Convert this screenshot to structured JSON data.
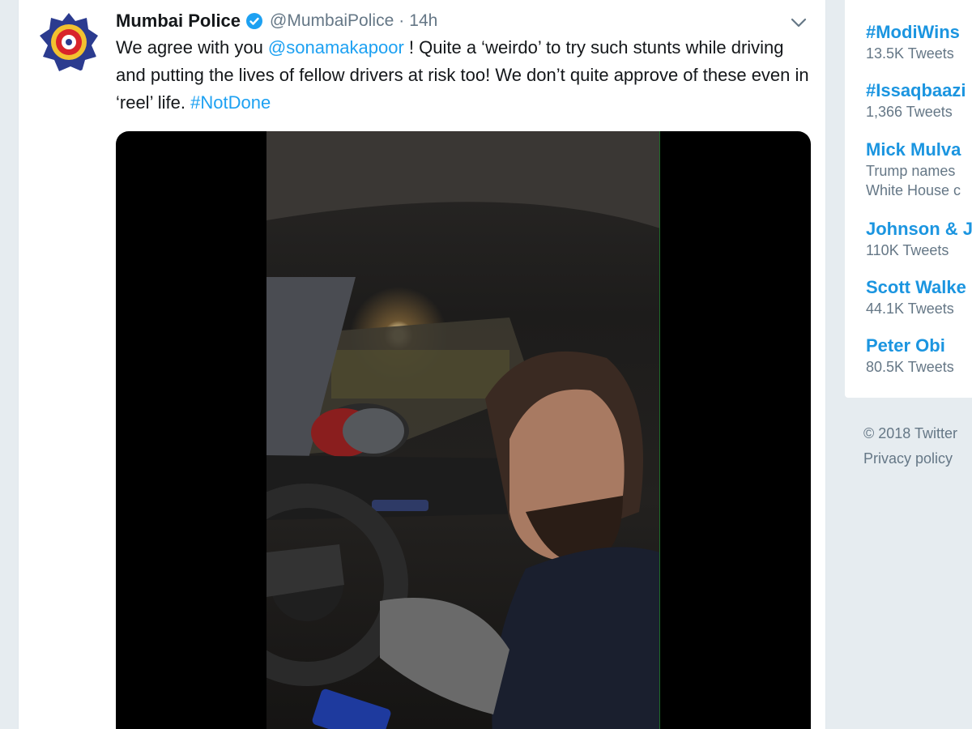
{
  "tweet": {
    "author_name": "Mumbai Police",
    "handle": "@MumbaiPolice",
    "separator": "·",
    "timestamp": "14h",
    "text_1": "We agree with you ",
    "mention": "@sonamakapoor",
    "text_2": " ! Quite a ‘weirdo’ to try such stunts while driving and putting the lives of fellow drivers at risk too! We don’t quite approve of these even in ‘reel’ life. ",
    "hashtag": "#NotDone",
    "icons": {
      "avatar": "police-badge",
      "verified": "verified-badge-icon",
      "menu": "chevron-down-icon"
    }
  },
  "media": {
    "type": "video"
  },
  "trends": {
    "items": [
      {
        "name": "#ModiWins",
        "meta": "13.5K Tweets"
      },
      {
        "name": "#Issaqbaazi",
        "meta": "1,366 Tweets"
      },
      {
        "name": "Mick Mulva",
        "meta_line1": "Trump names",
        "meta_line2": "White House c"
      },
      {
        "name": "Johnson & J",
        "meta": "110K Tweets"
      },
      {
        "name": "Scott Walke",
        "meta": "44.1K Tweets"
      },
      {
        "name": "Peter Obi",
        "meta": "80.5K Tweets"
      }
    ]
  },
  "footer": {
    "copyright": "© 2018 Twitter",
    "privacy": "Privacy policy"
  },
  "colors": {
    "link": "#1da1f2",
    "trend": "#1b95e0",
    "muted": "#657786",
    "background": "#e6ecf0"
  }
}
